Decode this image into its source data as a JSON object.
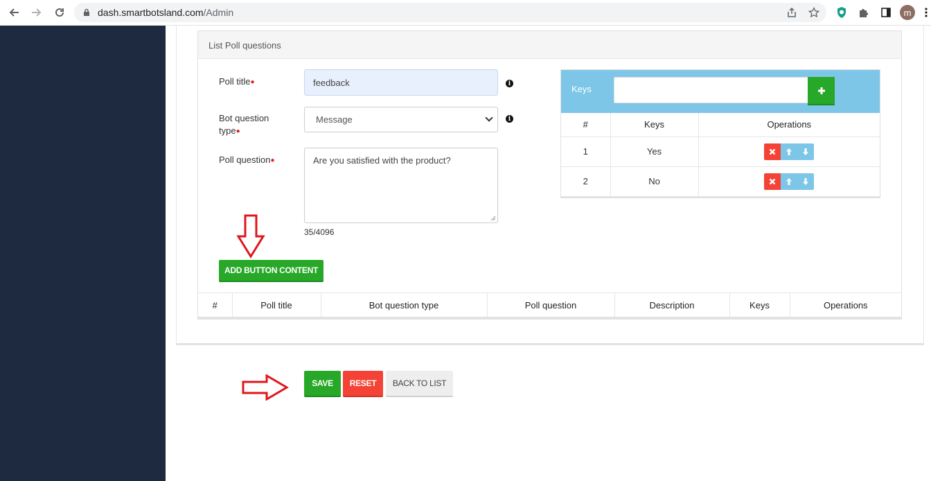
{
  "browser": {
    "url_host": "dash.smartbotsland.com",
    "url_path": "/Admin",
    "profile_initial": "m"
  },
  "panel": {
    "title": "List Poll questions"
  },
  "form": {
    "poll_title_label": "Poll title",
    "poll_title_value": "feedback",
    "bot_question_type_label_line1": "Bot question",
    "bot_question_type_label_line2": "type",
    "bot_question_type_value": "Message",
    "poll_question_label": "Poll question",
    "poll_question_value": "Are you satisfied with the product?",
    "char_counter": "35/4096",
    "required_mark": "●",
    "info_glyph": "i"
  },
  "keys": {
    "label": "Keys",
    "input_value": "",
    "add_icon": "plus-icon",
    "columns": [
      "#",
      "Keys",
      "Operations"
    ],
    "rows": [
      {
        "num": "1",
        "key": "Yes"
      },
      {
        "num": "2",
        "key": "No"
      }
    ]
  },
  "buttons": {
    "add_button_content": "ADD BUTTON CONTENT",
    "save": "SAVE",
    "reset": "RESET",
    "back_to_list": "BACK TO LIST"
  },
  "poll_table": {
    "columns": [
      "#",
      "Poll title",
      "Bot question type",
      "Poll question",
      "Description",
      "Keys",
      "Operations"
    ]
  },
  "colors": {
    "sidebar": "#1e2a3f",
    "green": "#28a828",
    "red": "#f44336",
    "keys_header": "#7dc6e8",
    "annotation_arrow": "#e0161b"
  }
}
